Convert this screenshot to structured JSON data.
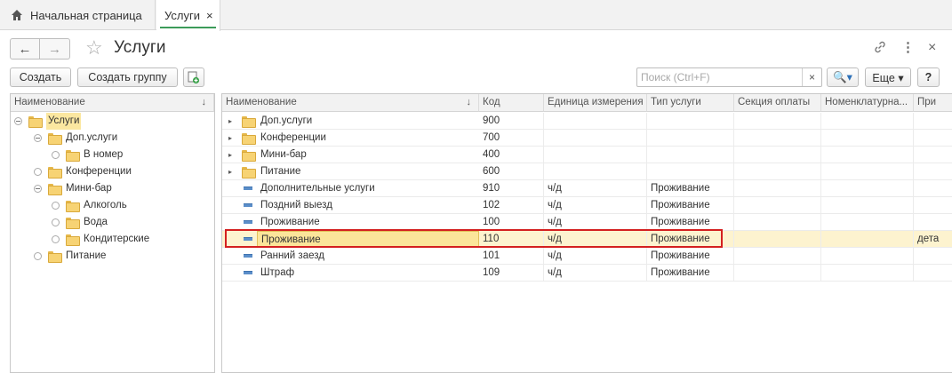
{
  "tabs": {
    "home_label": "Начальная страница",
    "active_label": "Услуги",
    "close_glyph": "×"
  },
  "header": {
    "title": "Услуги",
    "back_glyph": "←",
    "forward_glyph": "→",
    "star_glyph": "☆",
    "link_glyph": "🔗",
    "menu_glyph": "⋮",
    "close_glyph": "×"
  },
  "toolbar": {
    "create_label": "Создать",
    "create_group_label": "Создать группу",
    "search_placeholder": "Поиск (Ctrl+F)",
    "search_clear_glyph": "×",
    "search_btn_glyph": "🔍▾",
    "more_label": "Еще ▾",
    "help_label": "?"
  },
  "tree": {
    "header": "Наименование",
    "sort_glyph": "↓",
    "items": [
      {
        "label": "Услуги",
        "level": 0,
        "state": "expanded"
      },
      {
        "label": "Доп.услуги",
        "level": 1,
        "state": "expanded"
      },
      {
        "label": "В номер",
        "level": 2,
        "state": "leaf"
      },
      {
        "label": "Конференции",
        "level": 1,
        "state": "leaf"
      },
      {
        "label": "Мини-бар",
        "level": 1,
        "state": "expanded"
      },
      {
        "label": "Алкоголь",
        "level": 2,
        "state": "leaf"
      },
      {
        "label": "Вода",
        "level": 2,
        "state": "leaf"
      },
      {
        "label": "Кондитерские",
        "level": 2,
        "state": "leaf"
      },
      {
        "label": "Питание",
        "level": 1,
        "state": "leaf"
      }
    ]
  },
  "grid": {
    "columns": [
      "Наименование",
      "Код",
      "Единица измерения",
      "Тип услуги",
      "Секция оплаты",
      "Номенклатурна...",
      "При"
    ],
    "sort_glyph": "↓",
    "rows": [
      {
        "kind": "group",
        "name": "Доп.услуги",
        "code": "900",
        "unit": "",
        "type": "",
        "section": "",
        "nomen": "",
        "extra": ""
      },
      {
        "kind": "group",
        "name": "Конференции",
        "code": "700",
        "unit": "",
        "type": "",
        "section": "",
        "nomen": "",
        "extra": ""
      },
      {
        "kind": "group",
        "name": "Мини-бар",
        "code": "400",
        "unit": "",
        "type": "",
        "section": "",
        "nomen": "",
        "extra": ""
      },
      {
        "kind": "group",
        "name": "Питание",
        "code": "600",
        "unit": "",
        "type": "",
        "section": "",
        "nomen": "",
        "extra": ""
      },
      {
        "kind": "item",
        "name": "Дополнительные услуги",
        "code": "910",
        "unit": "ч/д",
        "type": "Проживание",
        "section": "",
        "nomen": "",
        "extra": ""
      },
      {
        "kind": "item",
        "name": "Поздний выезд",
        "code": "102",
        "unit": "ч/д",
        "type": "Проживание",
        "section": "",
        "nomen": "",
        "extra": ""
      },
      {
        "kind": "item",
        "name": "Проживание",
        "code": "100",
        "unit": "ч/д",
        "type": "Проживание",
        "section": "",
        "nomen": "",
        "extra": ""
      },
      {
        "kind": "item",
        "name": "Проживание",
        "code": "110",
        "unit": "ч/д",
        "type": "Проживание",
        "section": "",
        "nomen": "",
        "extra": "дета",
        "selected": true
      },
      {
        "kind": "item",
        "name": "Ранний заезд",
        "code": "101",
        "unit": "ч/д",
        "type": "Проживание",
        "section": "",
        "nomen": "",
        "extra": ""
      },
      {
        "kind": "item",
        "name": "Штраф",
        "code": "109",
        "unit": "ч/д",
        "type": "Проживание",
        "section": "",
        "nomen": "",
        "extra": ""
      }
    ]
  },
  "colors": {
    "accent_green": "#3c9b5a",
    "selection_frame": "#d42020",
    "selected_row": "#fdf3cf"
  }
}
